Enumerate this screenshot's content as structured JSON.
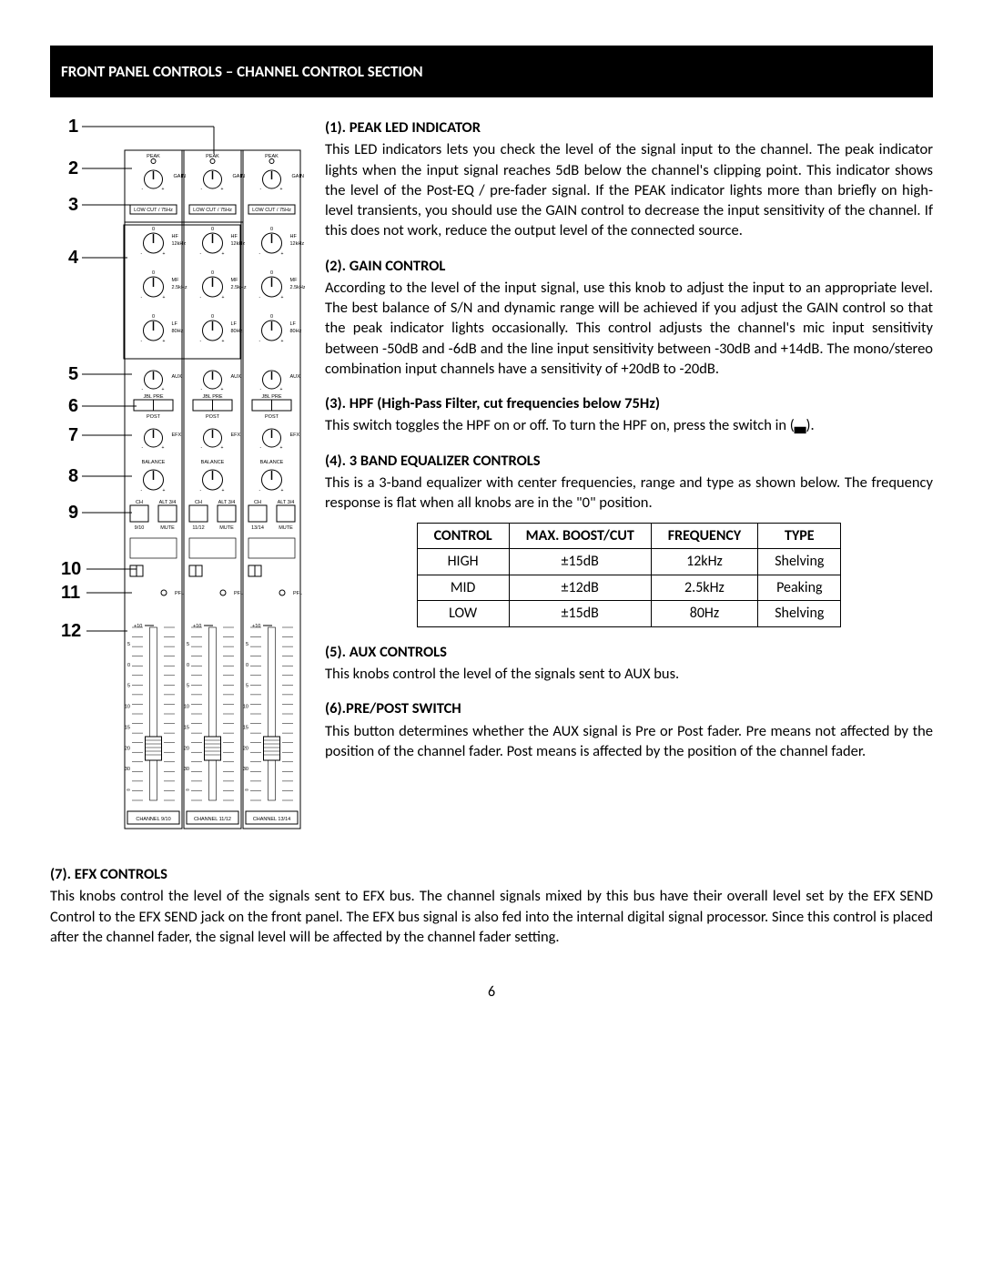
{
  "header": "FRONT PANEL CONTROLS – CHANNEL CONTROL SECTION",
  "callouts": [
    "1",
    "2",
    "3",
    "4",
    "5",
    "6",
    "7",
    "8",
    "9",
    "10",
    "11",
    "12"
  ],
  "diagram": {
    "peak": "PEAK",
    "gain": "GAIN",
    "lowcut": "LOW CUT / 75Hz",
    "hf": "HF",
    "hf_freq": "12kHz",
    "mf": "MF",
    "mf_freq": "2.5kHz",
    "lf": "LF",
    "lf_freq": "80Hz",
    "aux": "AUX",
    "prepost1": "JBL PRE",
    "prepost2": "POST",
    "efx": "EFX",
    "balance": "BALANCE",
    "ch": "CH",
    "alt": "ALT 3/4",
    "mute": "MUTE",
    "pfl": "PFL",
    "fader_top": "+10",
    "fader_marks": [
      "5",
      "0",
      "5",
      "10",
      "15",
      "20",
      "30",
      "∞"
    ],
    "ch_labels": [
      "CHANNEL 9/10",
      "CHANNEL 11/12",
      "CHANNEL 13/14"
    ],
    "ch_nums": [
      "9/10",
      "11/12",
      "13/14"
    ]
  },
  "sections": {
    "s1": {
      "title": "(1). PEAK LED INDICATOR",
      "body": "This LED indicators lets you check the level of the signal input to the channel. The peak indicator lights when the input signal reaches 5dB below the channel's clipping point. This indicator shows the level of the Post-EQ / pre-fader signal. If the PEAK indicator lights more than briefly on high-level transients, you should use the GAIN control to decrease the input sensitivity of the channel. If this does not work, reduce the output level of the connected source."
    },
    "s2": {
      "title": "(2). GAIN CONTROL",
      "body": "According to the level of the input signal, use this knob to adjust the input to an appropriate level. The best balance of S/N and dynamic range will be achieved if you adjust the GAIN control so that the peak indicator lights occasionally. This control adjusts the channel's mic input sensitivity between -50dB and -6dB and the line input sensitivity between -30dB and +14dB. The mono/stereo combination input channels have a sensitivity of +20dB to -20dB."
    },
    "s3": {
      "title": "(3). HPF (High-Pass Filter, cut frequencies below 75Hz)",
      "body": "This switch toggles the HPF on or off. To turn the HPF on, press the switch in (▃)."
    },
    "s4": {
      "title": "(4). 3 BAND EQUALIZER CONTROLS",
      "body": "This is a 3-band equalizer with center frequencies, range and type as shown below. The frequency response is flat when all knobs are in the \"0\" position."
    },
    "s5": {
      "title": "(5). AUX CONTROLS",
      "body": "This knobs control the level of the signals sent to AUX bus."
    },
    "s6": {
      "title": "(6).PRE/POST SWITCH",
      "body": "This button determines whether the AUX signal is Pre or Post fader. Pre means not affected by the position of the channel fader. Post means is affected by the position of the channel fader."
    },
    "s7": {
      "title": "(7). EFX CONTROLS",
      "body": "This knobs control the level of the signals sent to EFX bus. The channel signals mixed by this bus have their overall level set by the EFX SEND Control to the EFX SEND jack on the front panel. The EFX bus signal is also fed into the internal digital signal processor. Since this control is placed after the channel fader, the signal level will be affected by the channel fader setting."
    }
  },
  "eq_table": {
    "headers": [
      "CONTROL",
      "MAX. BOOST/CUT",
      "FREQUENCY",
      "TYPE"
    ],
    "rows": [
      [
        "HIGH",
        "±15dB",
        "12kHz",
        "Shelving"
      ],
      [
        "MID",
        "±12dB",
        "2.5kHz",
        "Peaking"
      ],
      [
        "LOW",
        "±15dB",
        "80Hz",
        "Shelving"
      ]
    ]
  },
  "page_number": "6"
}
